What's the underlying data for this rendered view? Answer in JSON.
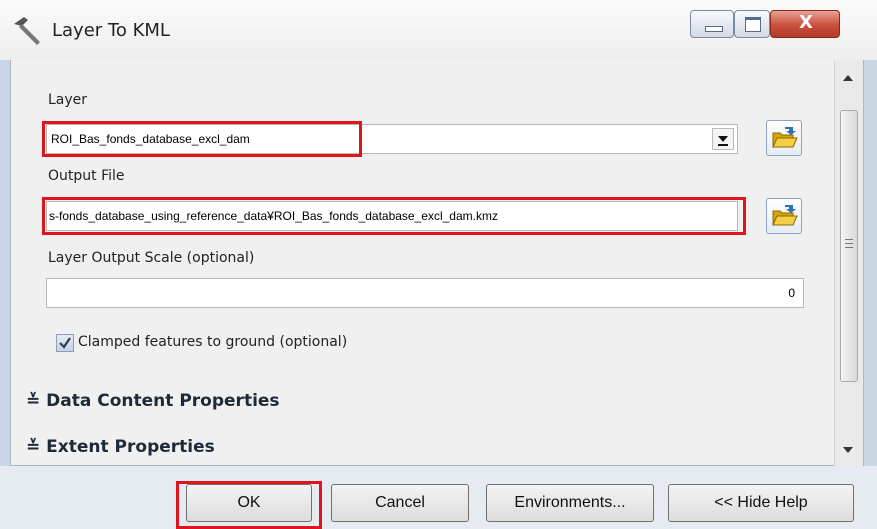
{
  "window": {
    "title": "Layer To KML",
    "close_glyph": "X"
  },
  "form": {
    "layer_label": "Layer",
    "layer_value": "ROI_Bas_fonds_database_excl_dam",
    "output_label": "Output File",
    "output_value": "s-fonds_database_using_reference_data¥ROI_Bas_fonds_database_excl_dam.kmz",
    "scale_label": "Layer Output Scale (optional)",
    "scale_value": "0",
    "clamp_label": "Clamped features to ground (optional)",
    "clamp_checked": true
  },
  "sections": {
    "data_content": "Data Content Properties",
    "extent": "Extent Properties",
    "expand_glyph": "≚"
  },
  "buttons": {
    "ok": "OK",
    "cancel": "Cancel",
    "environments": "Environments...",
    "hide_help": "<< Hide Help"
  },
  "colors": {
    "highlight": "#e0141c",
    "close_button": "#c8503c"
  },
  "icons": [
    "hammer-icon",
    "minimize-icon",
    "maximize-icon",
    "close-icon",
    "dropdown-arrow-icon",
    "open-folder-icon",
    "checkbox-check-icon",
    "chevron-double-down-icon",
    "scroll-up-icon",
    "scroll-down-icon",
    "scroll-grip-icon"
  ]
}
